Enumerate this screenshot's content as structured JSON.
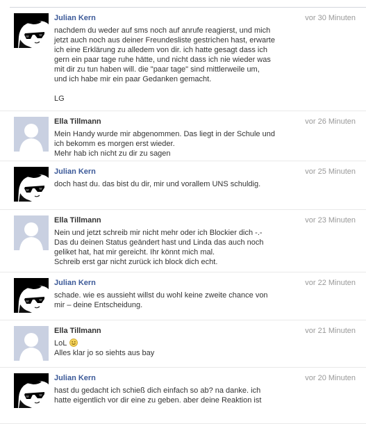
{
  "messages": [
    {
      "author": "Julian Kern",
      "author_is_link": true,
      "avatar": "julian-avatar-icon",
      "time": "vor 30 Minuten",
      "lines": [
        "nachdem du weder auf sms noch auf anrufe reagierst, und mich",
        "jetzt auch noch aus deiner Freundesliste gestrichen hast, erwarte",
        "ich eine Erklärung zu alledem von dir. ich hatte gesagt dass ich",
        "gern ein paar tage ruhe hätte, und nicht dass ich nie wieder was",
        "mit dir zu tun haben will. die \"paar tage\" sind mittlerweile um,",
        "und ich habe mir ein paar Gedanken gemacht.",
        "",
        "LG"
      ]
    },
    {
      "author": "Ella Tillmann",
      "author_is_link": false,
      "avatar": "default-avatar-icon",
      "time": "vor 26 Minuten",
      "lines": [
        "Mein Handy wurde mir abgenommen. Das liegt in der Schule und",
        "ich bekomm es morgen erst wieder.",
        "Mehr hab ich nicht zu dir zu sagen"
      ]
    },
    {
      "author": "Julian Kern",
      "author_is_link": true,
      "avatar": "julian-avatar-icon",
      "time": "vor 25 Minuten",
      "lines": [
        "doch hast du. das bist du dir, mir und vorallem UNS schuldig."
      ]
    },
    {
      "author": "Ella Tillmann",
      "author_is_link": false,
      "avatar": "default-avatar-icon",
      "time": "vor 23 Minuten",
      "lines": [
        "Nein und jetzt schreib mir nicht mehr oder ich Blockier dich -.-",
        "Das du deinen Status geändert hast und Linda das auch noch",
        "geliket hat, hat mir gereicht. Ihr könnt mich mal.",
        "Schreib erst gar nicht zurück ich block dich echt."
      ]
    },
    {
      "author": "Julian Kern",
      "author_is_link": true,
      "avatar": "julian-avatar-icon",
      "time": "vor 22 Minuten",
      "lines": [
        "schade. wie es aussieht willst du wohl keine zweite chance von",
        "mir – deine Entscheidung."
      ]
    },
    {
      "author": "Ella Tillmann",
      "author_is_link": false,
      "avatar": "default-avatar-icon",
      "time": "vor 21 Minuten",
      "lines": [
        "LoL",
        "Alles klar jo so siehts aus bay"
      ],
      "emoji_after_line": 0,
      "emoji": "smiley-emoji-icon"
    },
    {
      "author": "Julian Kern",
      "author_is_link": true,
      "avatar": "julian-avatar-icon",
      "time": "vor 20 Minuten",
      "lines": [
        "hast du gedacht ich schieß dich einfach so ab? na danke. ich",
        "hatte eigentlich vor dir eine zu geben. aber deine Reaktion ist"
      ]
    }
  ],
  "colors": {
    "link_blue": "#3b5998",
    "timestamp_gray": "#999999",
    "default_avatar_bg": "#c9d0e1",
    "default_avatar_fg": "#ffffff"
  }
}
